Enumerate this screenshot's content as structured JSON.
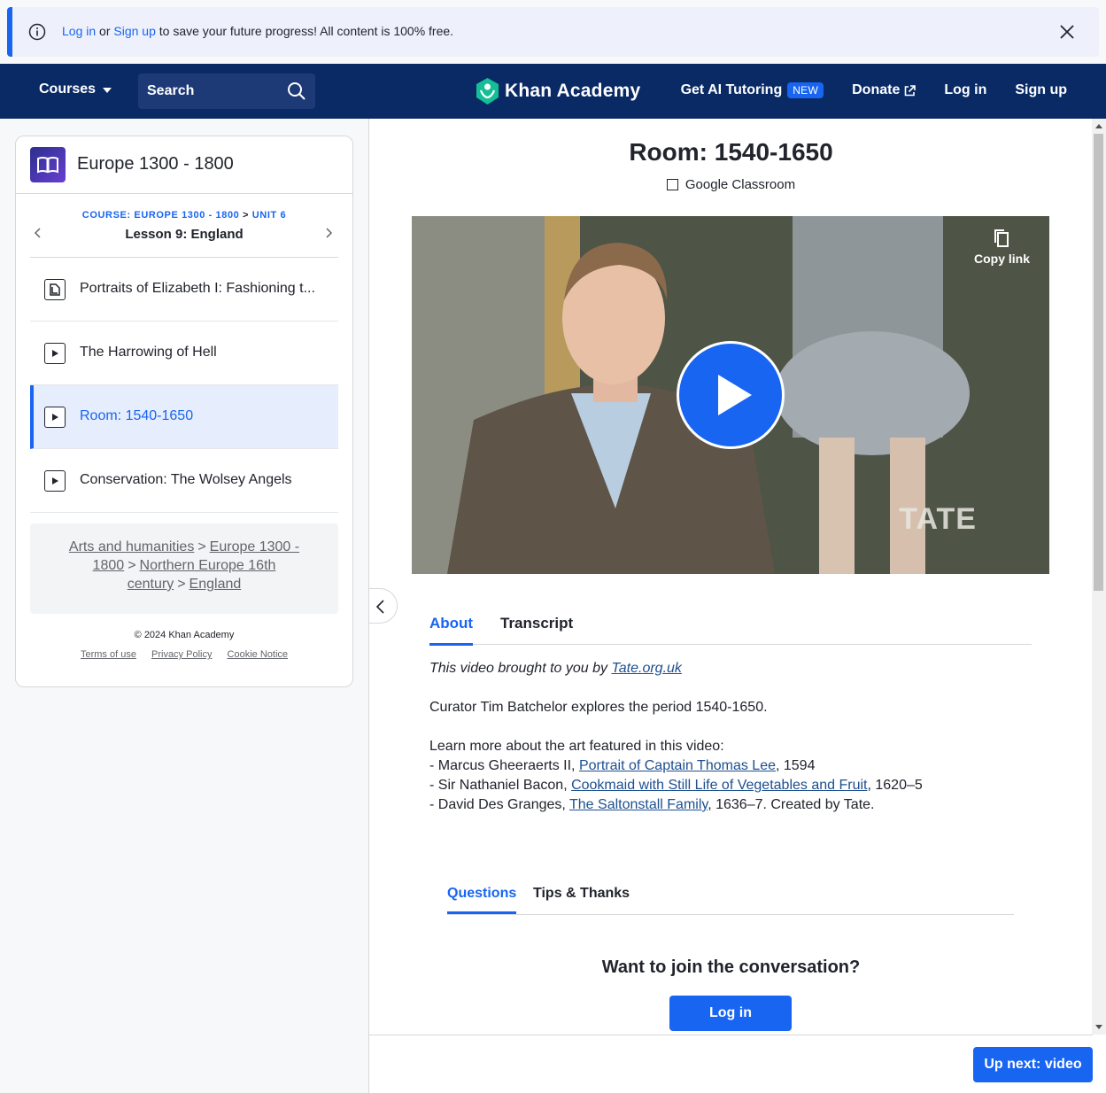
{
  "banner": {
    "login_link": "Log in",
    "or_text": " or ",
    "signup_link": "Sign up",
    "message": " to save your future progress! All content is 100% free."
  },
  "header": {
    "courses_label": "Courses",
    "search_label": "Search",
    "brand_name": "Khan Academy",
    "ai_tutoring": "Get AI Tutoring",
    "ai_badge": "NEW",
    "donate": "Donate",
    "login": "Log in",
    "signup": "Sign up"
  },
  "sidebar": {
    "course_title": "Europe 1300 - 1800",
    "crumb_course": "COURSE: EUROPE 1300 - 1800",
    "crumb_sep": " > ",
    "crumb_unit": "UNIT 6",
    "lesson": "Lesson 9: England",
    "items": [
      {
        "label": "Portraits of Elizabeth I: Fashioning t...",
        "type": "article"
      },
      {
        "label": "The Harrowing of Hell",
        "type": "video"
      },
      {
        "label": "Room: 1540-1650",
        "type": "video",
        "active": true
      },
      {
        "label": "Conservation: The Wolsey Angels",
        "type": "video"
      }
    ],
    "breadcrumbs": [
      "Arts and humanities",
      "Europe 1300 - 1800",
      "Northern Europe 16th century",
      "England"
    ],
    "copyright": "© 2024 Khan Academy",
    "footer_links": [
      "Terms of use",
      "Privacy Policy",
      "Cookie Notice"
    ]
  },
  "main": {
    "title": "Room: 1540-1650",
    "classroom": "Google Classroom",
    "copy_link": "Copy link",
    "video_watermark": "TATE",
    "tabs": [
      "About",
      "Transcript"
    ],
    "about": {
      "intro_prefix": "This video brought to you by ",
      "intro_link": "Tate.org.uk",
      "summary": "Curator Tim Batchelor explores the period 1540-1650.",
      "learn_more": "Learn more about the art featured in this video:",
      "works": [
        {
          "prefix": "- Marcus Gheeraerts II, ",
          "title": "Portrait of Captain Thomas Lee",
          "suffix": ", 1594"
        },
        {
          "prefix": "- Sir Nathaniel Bacon, ",
          "title": "Cookmaid with Still Life of Vegetables and Fruit",
          "suffix": ", 1620–5"
        },
        {
          "prefix": "- David Des Granges, ",
          "title": "The Saltonstall Family",
          "suffix": ", 1636–7. Created by Tate."
        }
      ]
    },
    "qtabs": [
      "Questions",
      "Tips & Thanks"
    ],
    "join_heading": "Want to join the conversation?",
    "join_login": "Log in",
    "up_next": "Up next: video"
  },
  "colors": {
    "accent": "#1865f2",
    "header_bg": "#0a2a66",
    "banner_bg": "#eef1fb",
    "active_item_bg": "#e6edfd"
  }
}
